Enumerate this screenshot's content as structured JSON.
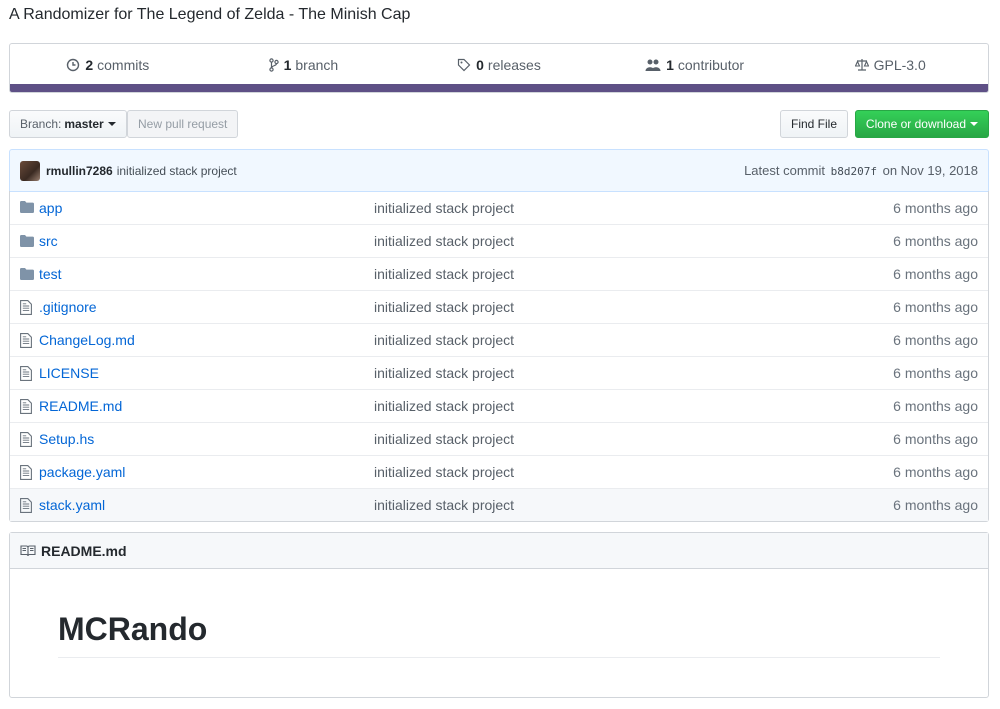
{
  "repo": {
    "description": "A Randomizer for The Legend of Zelda - The Minish Cap"
  },
  "summary": {
    "commits": {
      "count": "2",
      "label": "commits",
      "icon": "history-icon"
    },
    "branches": {
      "count": "1",
      "label": "branch",
      "icon": "git-branch-icon"
    },
    "releases": {
      "count": "0",
      "label": "releases",
      "icon": "tag-icon"
    },
    "contributors": {
      "count": "1",
      "label": "contributor",
      "icon": "people-icon"
    },
    "license": {
      "label": "GPL-3.0",
      "icon": "law-icon"
    },
    "language_bar_color": "#5e5086"
  },
  "toolbar": {
    "branch_label": "Branch:",
    "branch_value": "master",
    "new_pr_label": "New pull request",
    "find_file_label": "Find File",
    "clone_label": "Clone or download",
    "clone_color": "#28a745"
  },
  "latest_commit": {
    "author": "rmullin7286",
    "message": "initialized stack project",
    "prefix": "Latest commit",
    "sha": "b8d207f",
    "date": "on Nov 19, 2018"
  },
  "files": [
    {
      "name": "app",
      "type": "dir",
      "message": "initialized stack project",
      "age": "6 months ago"
    },
    {
      "name": "src",
      "type": "dir",
      "message": "initialized stack project",
      "age": "6 months ago"
    },
    {
      "name": "test",
      "type": "dir",
      "message": "initialized stack project",
      "age": "6 months ago"
    },
    {
      "name": ".gitignore",
      "type": "file",
      "message": "initialized stack project",
      "age": "6 months ago"
    },
    {
      "name": "ChangeLog.md",
      "type": "file",
      "message": "initialized stack project",
      "age": "6 months ago"
    },
    {
      "name": "LICENSE",
      "type": "file",
      "message": "initialized stack project",
      "age": "6 months ago"
    },
    {
      "name": "README.md",
      "type": "file",
      "message": "initialized stack project",
      "age": "6 months ago"
    },
    {
      "name": "Setup.hs",
      "type": "file",
      "message": "initialized stack project",
      "age": "6 months ago"
    },
    {
      "name": "package.yaml",
      "type": "file",
      "message": "initialized stack project",
      "age": "6 months ago"
    },
    {
      "name": "stack.yaml",
      "type": "file",
      "message": "initialized stack project",
      "age": "6 months ago"
    }
  ],
  "readme": {
    "header": "README.md",
    "title": "MCRando"
  }
}
